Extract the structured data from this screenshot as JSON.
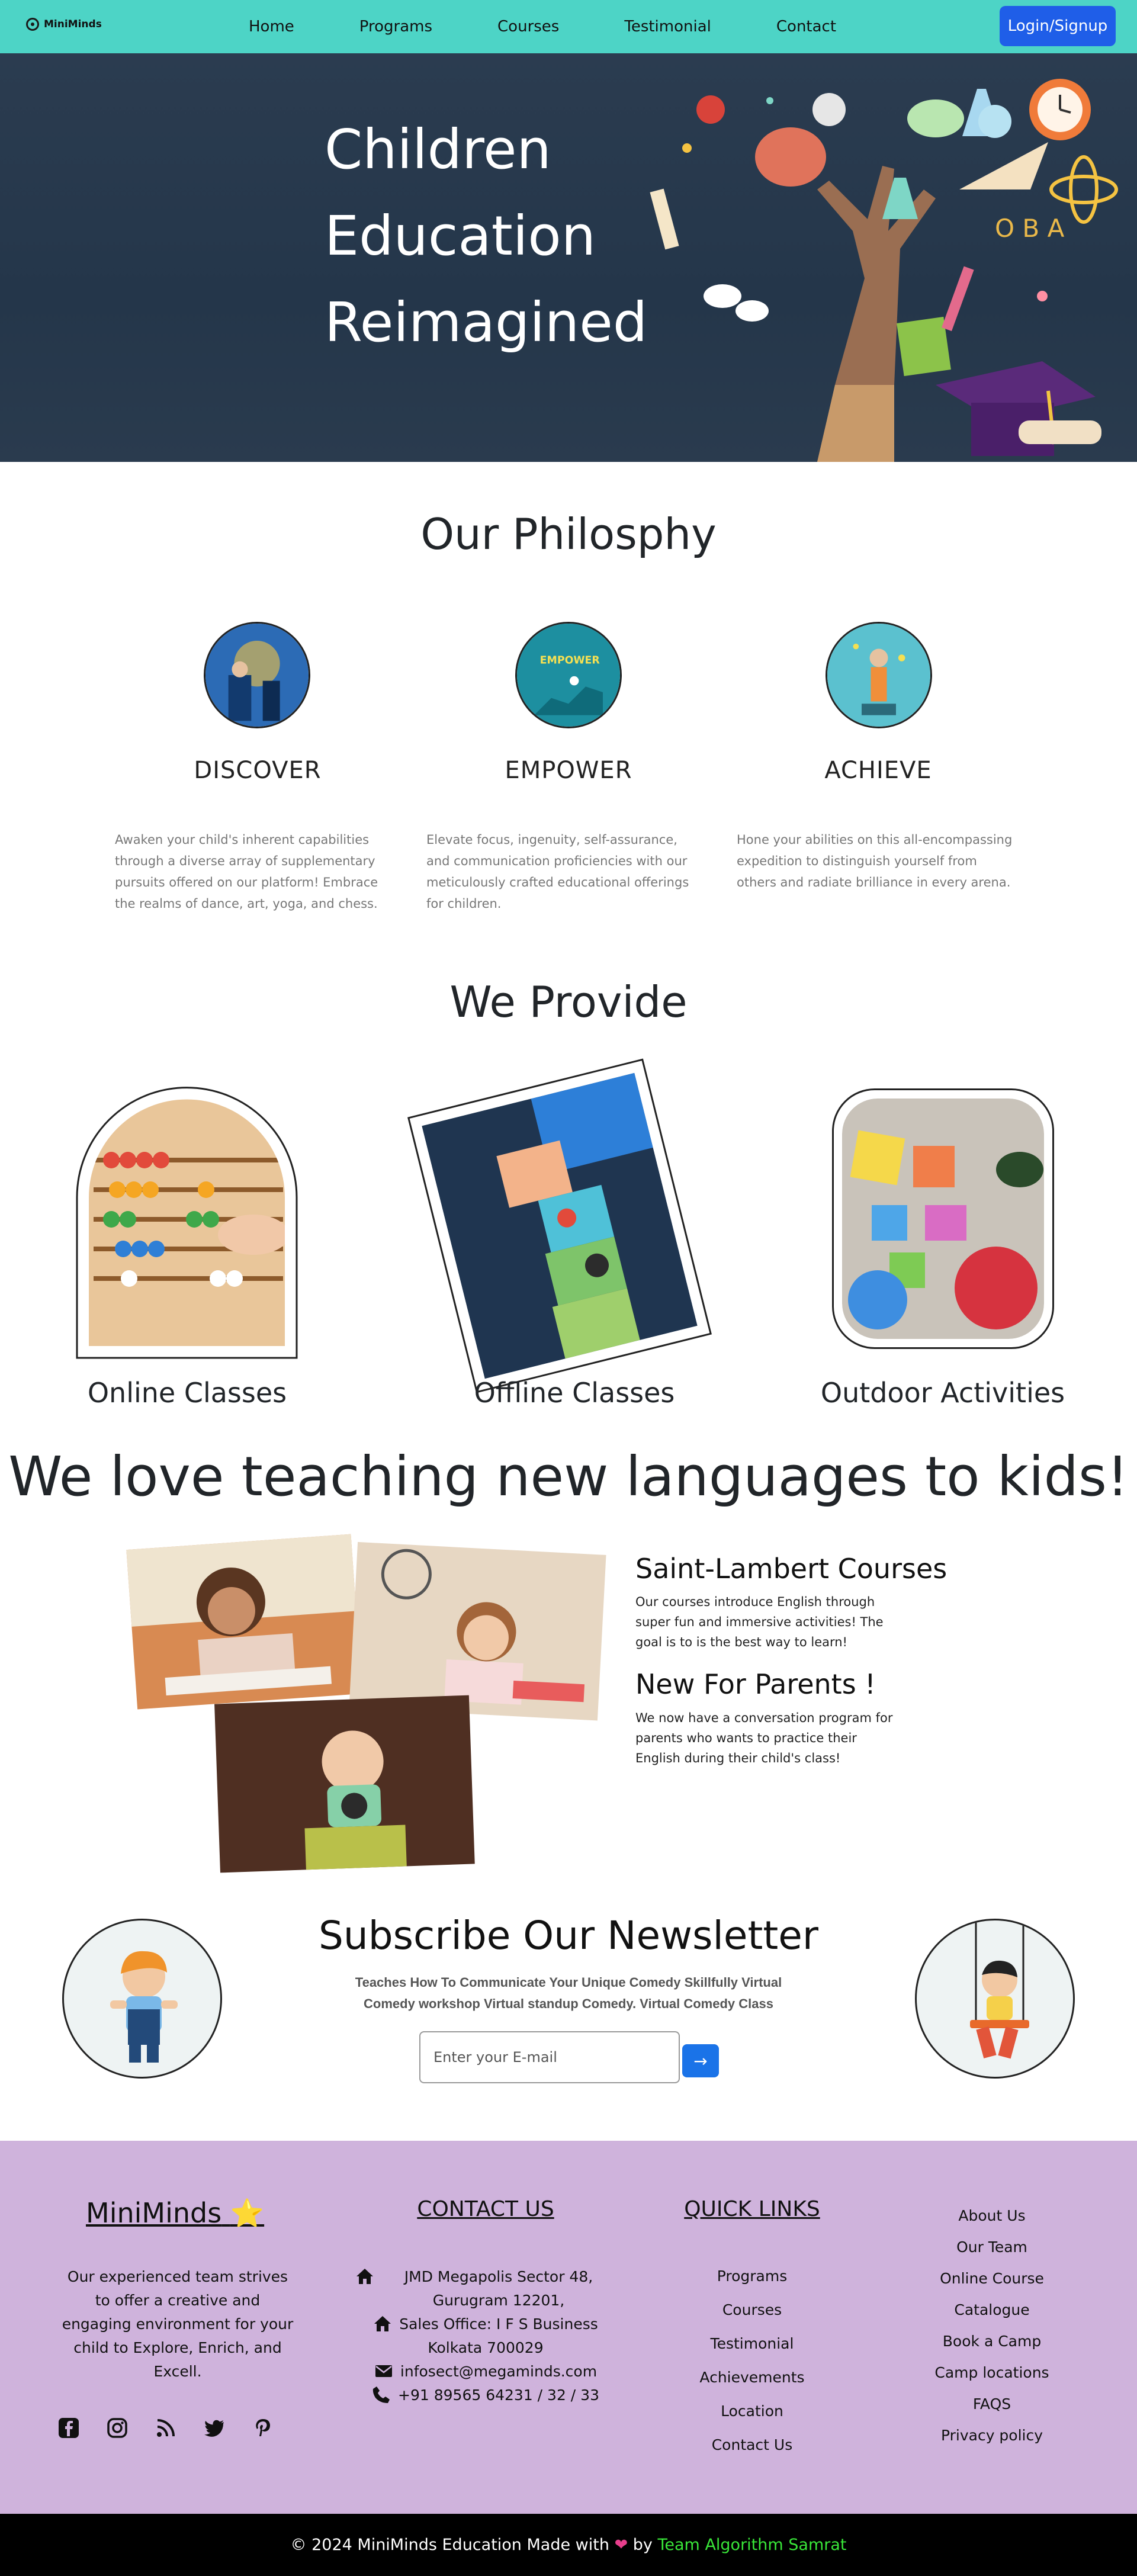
{
  "nav": {
    "brand": "MiniMinds",
    "links": [
      "Home",
      "Programs",
      "Courses",
      "Testimonial",
      "Contact"
    ],
    "login_label": "Login/Signup"
  },
  "hero": {
    "title_lines": [
      "Children",
      "Education",
      "Reimagined"
    ]
  },
  "philosophy": {
    "title": "Our Philosphy",
    "items": [
      {
        "heading": "DISCOVER",
        "text": "Awaken your child's inherent capabilities through a diverse array of supplementary pursuits offered on our platform! Embrace the realms of dance, art, yoga, and chess."
      },
      {
        "heading": "EMPOWER",
        "text": "Elevate focus, ingenuity, self-assurance, and communication proficiencies with our meticulously crafted educational offerings for children."
      },
      {
        "heading": "ACHIEVE",
        "text": "Hone your abilities on this all-encompassing expedition to distinguish yourself from others and radiate brilliance in every arena."
      }
    ]
  },
  "provide": {
    "title": "We Provide",
    "items": [
      "Online Classes",
      "Offline Classes",
      "Outdoor Activities"
    ]
  },
  "languages": {
    "title": "We love teaching new languages to kids!",
    "blocks": [
      {
        "heading": "Saint-Lambert Courses",
        "text": "Our courses introduce English through super fun and immersive activities! The goal is to is the best way to learn!"
      },
      {
        "heading": "New For Parents !",
        "text": "We now have a conversation program for parents who wants to practice their English during their child's class!"
      }
    ]
  },
  "newsletter": {
    "title": "Subscribe Our Newsletter",
    "subtitle": "Teaches How To Communicate Your Unique Comedy Skillfully Virtual Comedy workshop Virtual standup Comedy. Virtual Comedy Class",
    "placeholder": "Enter your E-mail",
    "button": "→"
  },
  "footer": {
    "brand": "MiniMinds",
    "brand_star": "⭐",
    "about": "Our experienced team strives to offer a creative and engaging environment for your child to Explore, Enrich, and Excell.",
    "social_icons": [
      "facebook-icon",
      "instagram-icon",
      "rss-icon",
      "twitter-icon",
      "pinterest-icon"
    ],
    "contact_title": "CONTACT US",
    "address1": "JMD Megapolis Sector 48, Gurugram 12201,",
    "address2": "Sales Office: I F S Business",
    "address2_cont": "Kolkata 700029",
    "email": "infosect@megaminds.com",
    "phone": "+91 89565 64231 / 32 / 33",
    "quick_title": "QUICK LINKS",
    "quick_links": [
      "Programs",
      "Courses",
      "Testimonial",
      "Achievements",
      "Location",
      "Contact Us"
    ],
    "more_links": [
      "About Us",
      "Our Team",
      "Online Course",
      "Catalogue",
      "Book a Camp",
      "Camp locations",
      "FAQS",
      "Privacy policy"
    ]
  },
  "copyright": {
    "prefix": "© 2024 MiniMinds Education Made with",
    "heart": "❤",
    "by": "by",
    "team": "Team Algorithm Samrat"
  },
  "colors": {
    "nav_bg": "#4dd4c6",
    "login_bg": "#1f5ee8",
    "hero_bg": "#2b3c50",
    "footer_bg": "#cfb3dc",
    "copyright_bg": "#000000",
    "team_green": "#39e639"
  }
}
